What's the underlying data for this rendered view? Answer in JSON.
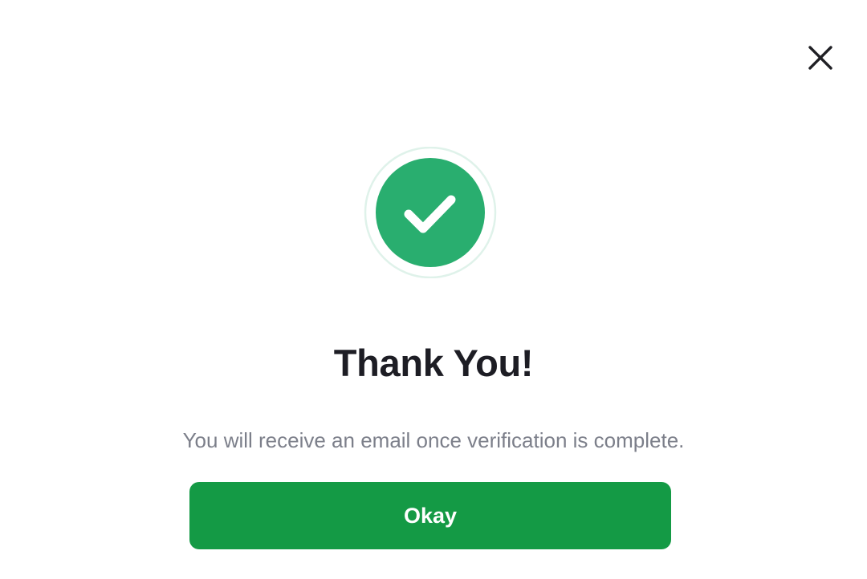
{
  "dialog": {
    "close_icon": "close-icon",
    "status_icon": "checkmark-icon",
    "title": "Thank You!",
    "message": "You will receive an email once verification is complete.",
    "primary_button_label": "Okay"
  },
  "colors": {
    "success_green": "#29ae6f",
    "success_ring": "#dff2ea",
    "button_green": "#149a45",
    "title_text": "#1d1d24",
    "message_text": "#7c7f8a"
  }
}
